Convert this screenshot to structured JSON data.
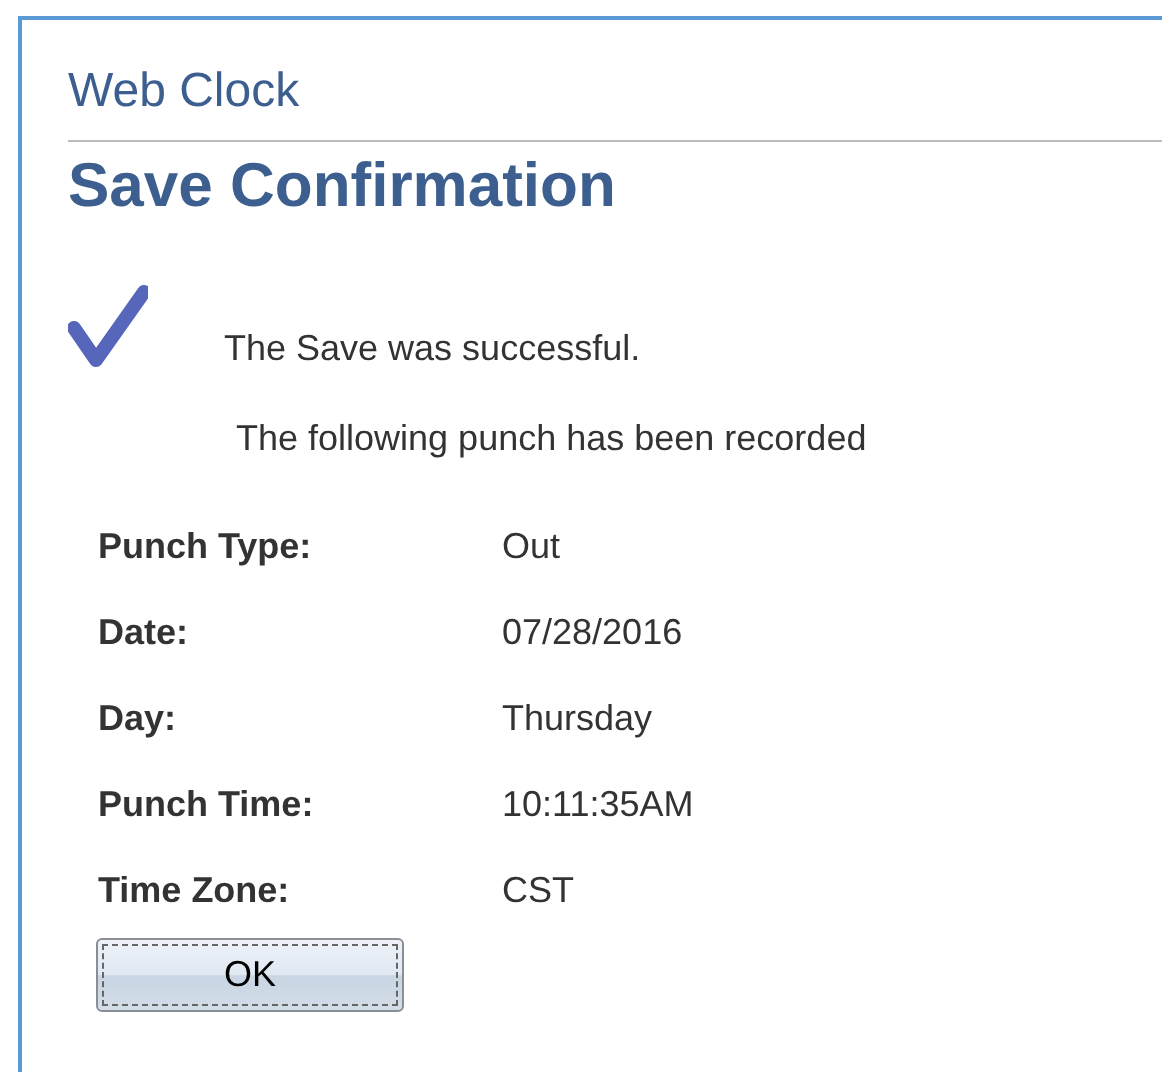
{
  "header": {
    "title": "Web Clock"
  },
  "page_title": "Save Confirmation",
  "message": {
    "success": "The Save was successful.",
    "detail": "The following punch has been recorded"
  },
  "fields": [
    {
      "label": "Punch Type:",
      "value": "Out"
    },
    {
      "label": "Date:",
      "value": "07/28/2016"
    },
    {
      "label": "Day:",
      "value": "Thursday"
    },
    {
      "label": "Punch Time:",
      "value": "10:11:35AM"
    },
    {
      "label": "Time Zone:",
      "value": "CST"
    }
  ],
  "buttons": [
    "OK"
  ]
}
